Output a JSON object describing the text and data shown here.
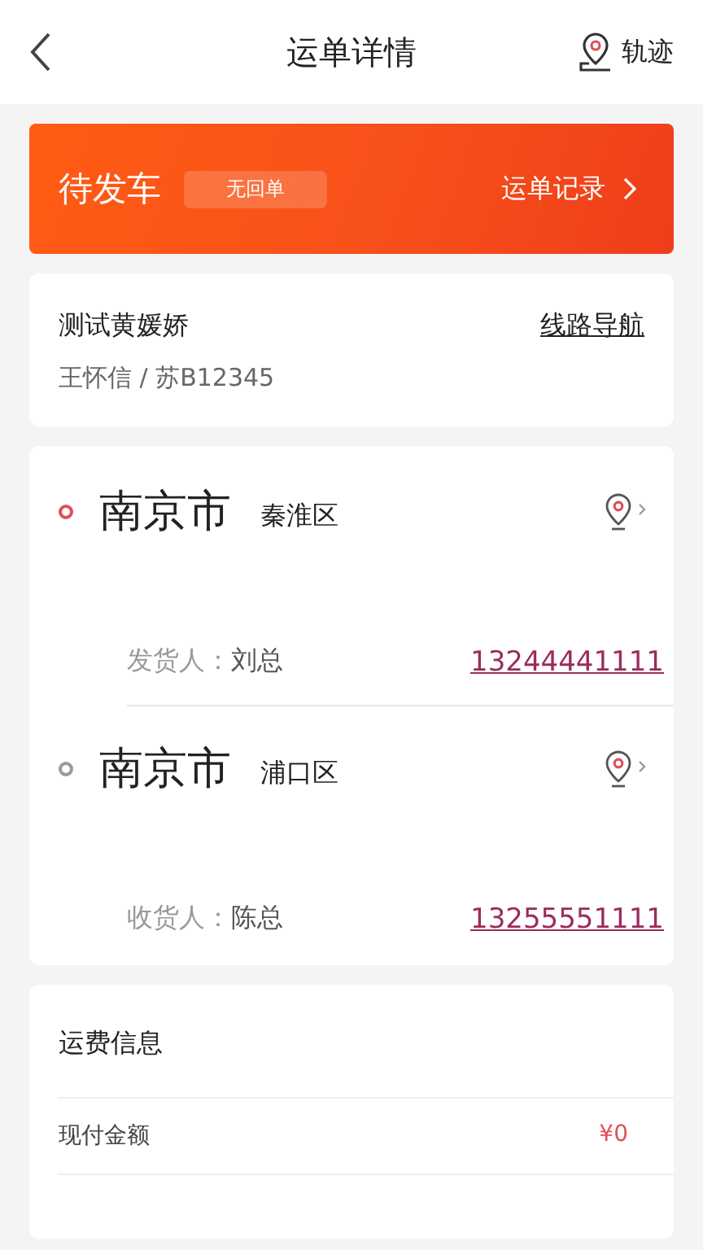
{
  "header": {
    "title": "运单详情",
    "track_label": "轨迹"
  },
  "status_banner": {
    "status": "待发车",
    "tag": "无回单",
    "record_link": "运单记录"
  },
  "driver_card": {
    "title": "测试黄媛娇",
    "subtitle": "王怀信 / 苏B12345",
    "nav_link": "线路导航"
  },
  "route": [
    {
      "city": "南京市",
      "district": "秦淮区",
      "color": "#e0505a",
      "contact_label": "发货人：",
      "contact_name": "刘总",
      "phone": "13244441111"
    },
    {
      "city": "南京市",
      "district": "浦口区",
      "color": "#9a9a9a",
      "contact_label": "收货人：",
      "contact_name": "陈总",
      "phone": "13255551111"
    }
  ],
  "fee_card": {
    "title": "运费信息",
    "rows": [
      {
        "label": "现付金额",
        "value": "¥0"
      }
    ]
  }
}
